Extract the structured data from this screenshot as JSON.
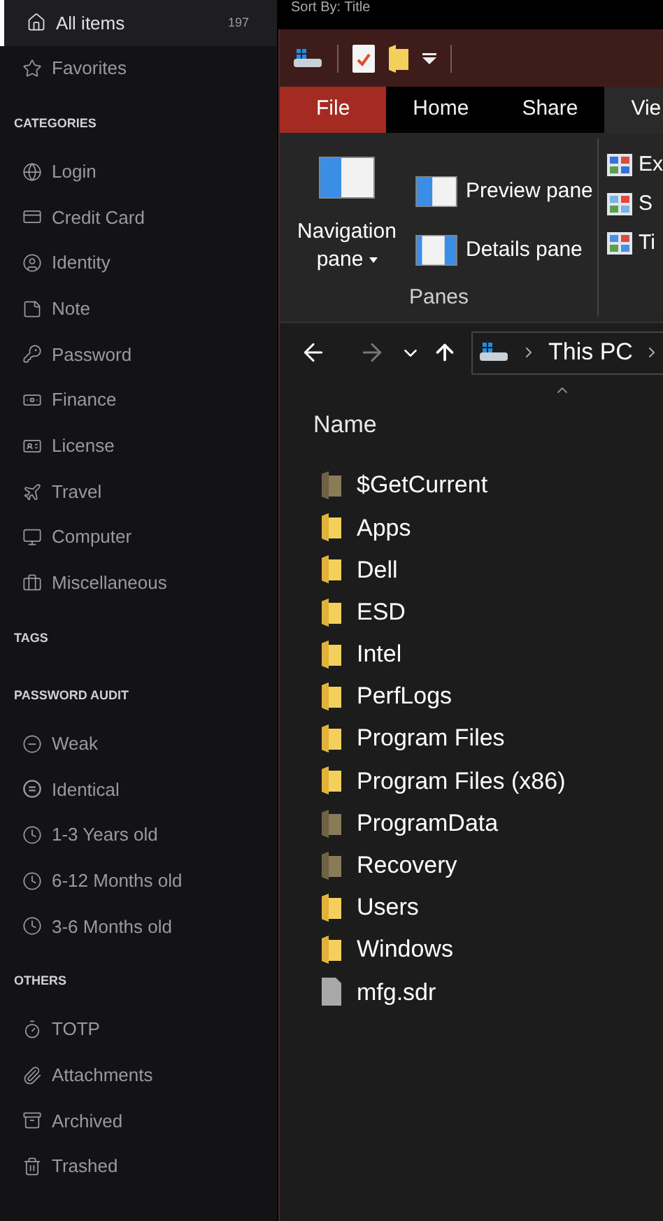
{
  "background": {
    "sort_label": "Sort By: Title"
  },
  "sidebar": {
    "sections": [
      {
        "items": [
          {
            "label": "All items",
            "count": "197",
            "selected": true
          },
          {
            "label": "Favorites",
            "selected": false
          }
        ]
      },
      {
        "heading": "CATEGORIES",
        "items": [
          {
            "label": "Login",
            "selected": false
          },
          {
            "label": "Credit Card",
            "selected": false
          },
          {
            "label": "Identity",
            "selected": false
          },
          {
            "label": "Note",
            "selected": false
          },
          {
            "label": "Password",
            "selected": false
          },
          {
            "label": "Finance",
            "selected": false
          },
          {
            "label": "License",
            "selected": false
          },
          {
            "label": "Travel",
            "selected": false
          },
          {
            "label": "Computer",
            "selected": false
          },
          {
            "label": "Miscellaneous",
            "selected": false
          }
        ]
      },
      {
        "heading": "TAGS"
      },
      {
        "heading": "PASSWORD AUDIT",
        "items": [
          {
            "label": "Weak",
            "selected": false
          },
          {
            "label": "Identical",
            "selected": false
          },
          {
            "label": "1-3 Years old",
            "selected": false
          },
          {
            "label": "6-12 Months old",
            "selected": false
          },
          {
            "label": "3-6 Months old",
            "selected": false
          }
        ]
      },
      {
        "heading": "OTHERS",
        "items": [
          {
            "label": "TOTP",
            "selected": false
          },
          {
            "label": "Attachments",
            "selected": false
          },
          {
            "label": "Archived",
            "selected": false
          },
          {
            "label": "Trashed",
            "selected": false
          }
        ]
      }
    ]
  },
  "explorer": {
    "ribbon_tabs": [
      {
        "label": "File",
        "kind": "file",
        "selected": false
      },
      {
        "label": "Home",
        "kind": "tab",
        "selected": false
      },
      {
        "label": "Share",
        "kind": "tab",
        "selected": false
      },
      {
        "label": "Vie",
        "kind": "tab",
        "selected": true
      }
    ],
    "panes_group": {
      "label": "Panes",
      "large_button": "Navigation pane",
      "small_buttons": [
        "Preview pane",
        "Details pane"
      ]
    },
    "layout_group": {
      "items": [
        "Ex",
        "S",
        "Ti"
      ]
    },
    "address": {
      "path": [
        "This PC"
      ]
    },
    "column_header": "Name",
    "files": [
      {
        "name": "$GetCurrent",
        "kind": "folder",
        "hidden": true
      },
      {
        "name": "Apps",
        "kind": "folder",
        "hidden": false
      },
      {
        "name": "Dell",
        "kind": "folder",
        "hidden": false
      },
      {
        "name": "ESD",
        "kind": "folder",
        "hidden": false
      },
      {
        "name": "Intel",
        "kind": "folder",
        "hidden": false
      },
      {
        "name": "PerfLogs",
        "kind": "folder",
        "hidden": false
      },
      {
        "name": "Program Files",
        "kind": "folder",
        "hidden": false
      },
      {
        "name": "Program Files (x86)",
        "kind": "folder",
        "hidden": false
      },
      {
        "name": "ProgramData",
        "kind": "folder",
        "hidden": true
      },
      {
        "name": "Recovery",
        "kind": "folder",
        "hidden": true
      },
      {
        "name": "Users",
        "kind": "folder",
        "hidden": false
      },
      {
        "name": "Windows",
        "kind": "folder",
        "hidden": false
      },
      {
        "name": "mfg.sdr",
        "kind": "file"
      }
    ]
  }
}
